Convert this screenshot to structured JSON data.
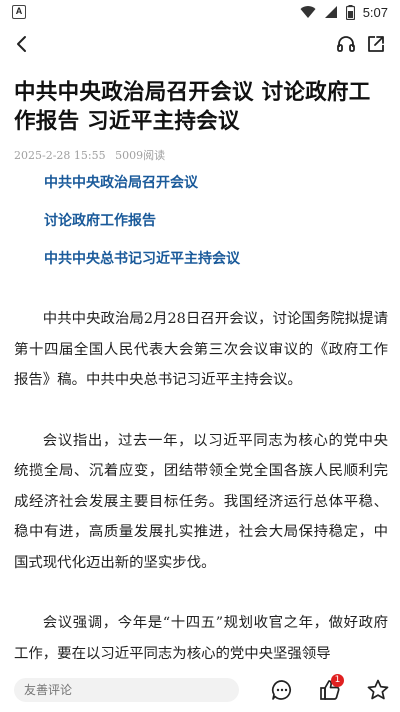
{
  "status_bar": {
    "time": "5:07",
    "left_icon": "A",
    "icons": [
      "wifi-icon",
      "signal-icon",
      "battery-icon"
    ]
  },
  "header": {
    "back_icon": "chevron-left-icon",
    "listen_icon": "headphones-icon",
    "share_icon": "share-icon"
  },
  "article": {
    "title": "中共中央政治局召开会议  讨论政府工作报告  习近平主持会议",
    "date": "2025-2-28  15:55",
    "reads": "5009阅读",
    "toc": [
      "中共中央政治局召开会议",
      "讨论政府工作报告",
      "中共中央总书记习近平主持会议"
    ],
    "paragraphs": [
      "中共中央政治局2月28日召开会议，讨论国务院拟提请第十四届全国人民代表大会第三次会议审议的《政府工作报告》稿。中共中央总书记习近平主持会议。",
      "会议指出，过去一年，以习近平同志为核心的党中央统揽全局、沉着应变，团结带领全党全国各族人民顺利完成经济社会发展主要目标任务。我国经济运行总体平稳、稳中有进，高质量发展扎实推进，社会大局保持稳定，中国式现代化迈出新的坚实步伐。",
      "会议强调，今年是“十四五”规划收官之年，做好政府工作，要在以习近平同志为核心的党中央坚强领导"
    ]
  },
  "bottom_bar": {
    "comment_placeholder": "友善评论",
    "like_count": "1",
    "accent": "#1a5a9a",
    "badge_color": "#e02020"
  }
}
